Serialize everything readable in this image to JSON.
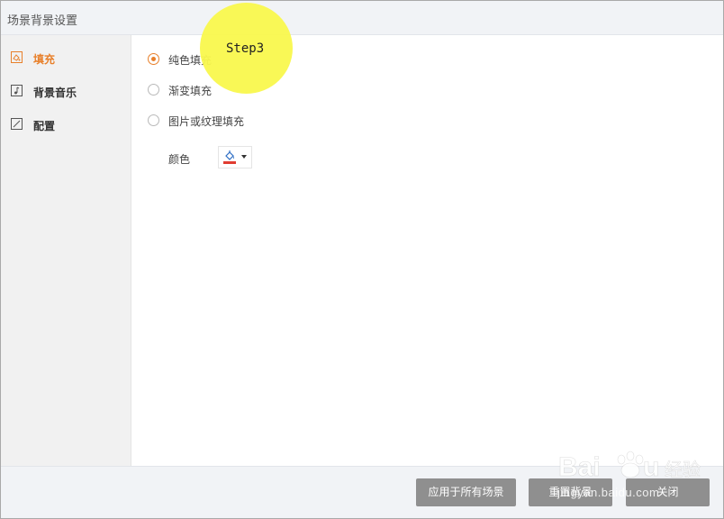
{
  "window": {
    "title": "场景背景设置"
  },
  "sidebar": {
    "items": [
      {
        "label": "填充",
        "icon": "fill-icon",
        "active": true
      },
      {
        "label": "背景音乐",
        "icon": "music-note-icon",
        "active": false
      },
      {
        "label": "配置",
        "icon": "config-icon",
        "active": false
      }
    ]
  },
  "fill_options": {
    "options": [
      {
        "label": "纯色填充",
        "checked": true
      },
      {
        "label": "渐变填充",
        "checked": false
      },
      {
        "label": "图片或纹理填充",
        "checked": false
      }
    ],
    "color_label": "颜色",
    "color_value": "#e03c31"
  },
  "annotation": {
    "step_label": "Step3",
    "color": "#f9f84d"
  },
  "footer": {
    "apply_all_label": "应用于所有场景",
    "reset_label": "重置背景",
    "close_label": "关闭"
  },
  "watermark": {
    "text": "jingyan.baidu.com",
    "brand": "Baidu 经验"
  },
  "colors": {
    "accent": "#e8802b",
    "button_bg": "#8f8f8f"
  }
}
